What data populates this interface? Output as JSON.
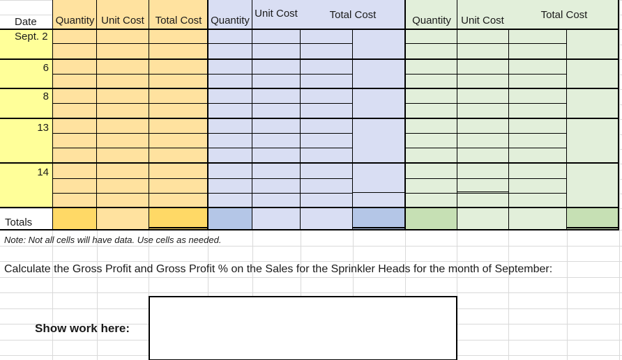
{
  "colors": {
    "date_col": "#ffff99",
    "purchases": "#ffe29f",
    "purchases_totals_dark": "#ffd966",
    "cogs": "#d9def3",
    "cogs_totals_dark": "#b4c6e7",
    "balance": "#e2efda",
    "balance_totals_dark": "#c6e0b4",
    "gridline": "#d9d9d9",
    "border": "#000000"
  },
  "header": {
    "date": "Date",
    "purchases": {
      "quantity": "Quantity",
      "unit_cost": "Unit Cost",
      "total_cost": "Total Cost"
    },
    "cogs": {
      "quantity": "Quantity",
      "unit_cost": "Unit Cost",
      "total_cost": "Total Cost"
    },
    "balance": {
      "quantity": "Quantity",
      "unit_cost": "Unit Cost",
      "total_cost": "Total Cost"
    }
  },
  "dates": [
    "Sept. 2",
    "6",
    "8",
    "13",
    "14"
  ],
  "totals_label": "Totals",
  "note": "Note:  Not all cells will have data.  Use cells as needed.",
  "prompt": "Calculate the Gross Profit and Gross Profit %  on the Sales for the Sprinkler Heads for the month of September:",
  "work_label": "Show work here:"
}
